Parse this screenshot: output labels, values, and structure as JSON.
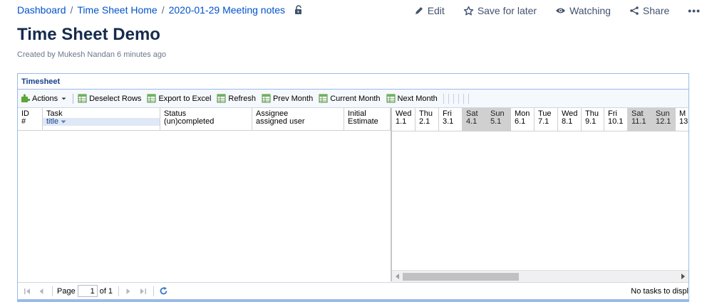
{
  "breadcrumb": {
    "items": [
      "Dashboard",
      "Time Sheet Home",
      "2020-01-29 Meeting notes"
    ],
    "separator": "/"
  },
  "actions": {
    "edit": "Edit",
    "save": "Save for later",
    "watching": "Watching",
    "share": "Share",
    "more": "•••"
  },
  "page": {
    "title": "Time Sheet Demo",
    "byline": "Created by Mukesh Nandan 6 minutes ago"
  },
  "panel": {
    "title": "Timesheet"
  },
  "toolbar": {
    "actions": "Actions",
    "deselect": "Deselect Rows",
    "export": "Export to Excel",
    "refresh": "Refresh",
    "prev_month": "Prev Month",
    "current_month": "Current Month",
    "next_month": "Next Month"
  },
  "columns": {
    "id": [
      "ID",
      "#"
    ],
    "task": [
      "Task",
      "title"
    ],
    "status": [
      "Status",
      "(un)completed"
    ],
    "assignee": [
      "Assignee",
      "assigned user"
    ],
    "estimate": [
      "Initial",
      "Estimate"
    ]
  },
  "days": [
    {
      "dow": "Wed",
      "date": "1.1",
      "weekend": false
    },
    {
      "dow": "Thu",
      "date": "2.1",
      "weekend": false
    },
    {
      "dow": "Fri",
      "date": "3.1",
      "weekend": false
    },
    {
      "dow": "Sat",
      "date": "4.1",
      "weekend": true
    },
    {
      "dow": "Sun",
      "date": "5.1",
      "weekend": true
    },
    {
      "dow": "Mon",
      "date": "6.1",
      "weekend": false
    },
    {
      "dow": "Tue",
      "date": "7.1",
      "weekend": false
    },
    {
      "dow": "Wed",
      "date": "8.1",
      "weekend": false
    },
    {
      "dow": "Thu",
      "date": "9.1",
      "weekend": false
    },
    {
      "dow": "Fri",
      "date": "10.1",
      "weekend": false
    },
    {
      "dow": "Sat",
      "date": "11.1",
      "weekend": true
    },
    {
      "dow": "Sun",
      "date": "12.1",
      "weekend": true
    },
    {
      "dow": "M",
      "date": "13",
      "weekend": false
    }
  ],
  "pager": {
    "page_label": "Page",
    "page_value": "1",
    "of_label": "of 1",
    "status": "No tasks to displ"
  },
  "colors": {
    "link": "#0052cc",
    "panel_border": "#99bbe8",
    "weekend_bg": "#d0d0d0"
  }
}
